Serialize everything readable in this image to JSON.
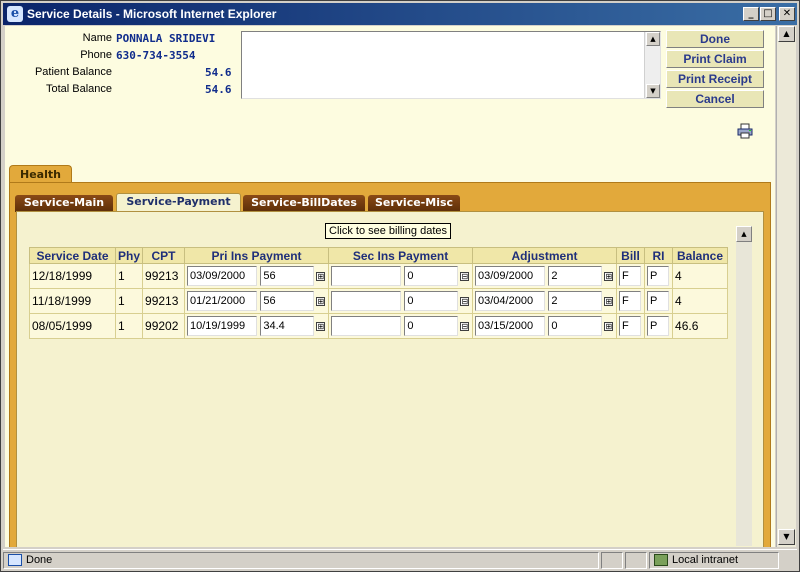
{
  "window": {
    "title": "Service Details - Microsoft Internet Explorer",
    "controls": {
      "minimize": "_",
      "maximize": "□",
      "close": "✕"
    }
  },
  "patient": {
    "name_label": "Name",
    "name": "PONNALA SRIDEVI",
    "phone_label": "Phone",
    "phone": "630-734-3554",
    "patient_balance_label": "Patient Balance",
    "patient_balance": "54.6",
    "total_balance_label": "Total Balance",
    "total_balance": "54.6"
  },
  "actions": {
    "done": "Done",
    "print_claim": "Print Claim",
    "print_receipt": "Print Receipt",
    "cancel": "Cancel"
  },
  "icons": {
    "print": "printer-icon",
    "ie": "ie-logo-icon",
    "local_intranet": "intranet-icon"
  },
  "tabs": {
    "main": "Health",
    "sub": [
      "Service-Main",
      "Service-Payment",
      "Service-BillDates",
      "Service-Misc"
    ],
    "active_sub": "Service-Payment"
  },
  "tooltip": "Click to see billing dates",
  "table": {
    "headers": {
      "service_date": "Service Date",
      "phy": "Phy",
      "cpt": "CPT",
      "pri_ins_payment": "Pri Ins Payment",
      "sec_ins_payment": "Sec Ins Payment",
      "adjustment": "Adjustment",
      "bill": "Bill",
      "ri": "RI",
      "balance": "Balance"
    },
    "rows": [
      {
        "service_date": "12/18/1999",
        "phy": "1",
        "cpt": "99213",
        "pri_date": "03/09/2000",
        "pri_amount": "56",
        "sec_date": "",
        "sec_amount": "0",
        "adj_date": "03/09/2000",
        "adj_amount": "2",
        "bill": "F",
        "ri": "P",
        "balance": "4"
      },
      {
        "service_date": "11/18/1999",
        "phy": "1",
        "cpt": "99213",
        "pri_date": "01/21/2000",
        "pri_amount": "56",
        "sec_date": "",
        "sec_amount": "0",
        "adj_date": "03/04/2000",
        "adj_amount": "2",
        "bill": "F",
        "ri": "P",
        "balance": "4"
      },
      {
        "service_date": "08/05/1999",
        "phy": "1",
        "cpt": "99202",
        "pri_date": "10/19/1999",
        "pri_amount": "34.4",
        "sec_date": "",
        "sec_amount": "0",
        "adj_date": "03/15/2000",
        "adj_amount": "0",
        "bill": "F",
        "ri": "P",
        "balance": "46.6"
      }
    ],
    "expand_symbol": "⊞",
    "collapse_symbol": "⊟"
  },
  "status": {
    "text": "Done",
    "zone": "Local intranet"
  }
}
